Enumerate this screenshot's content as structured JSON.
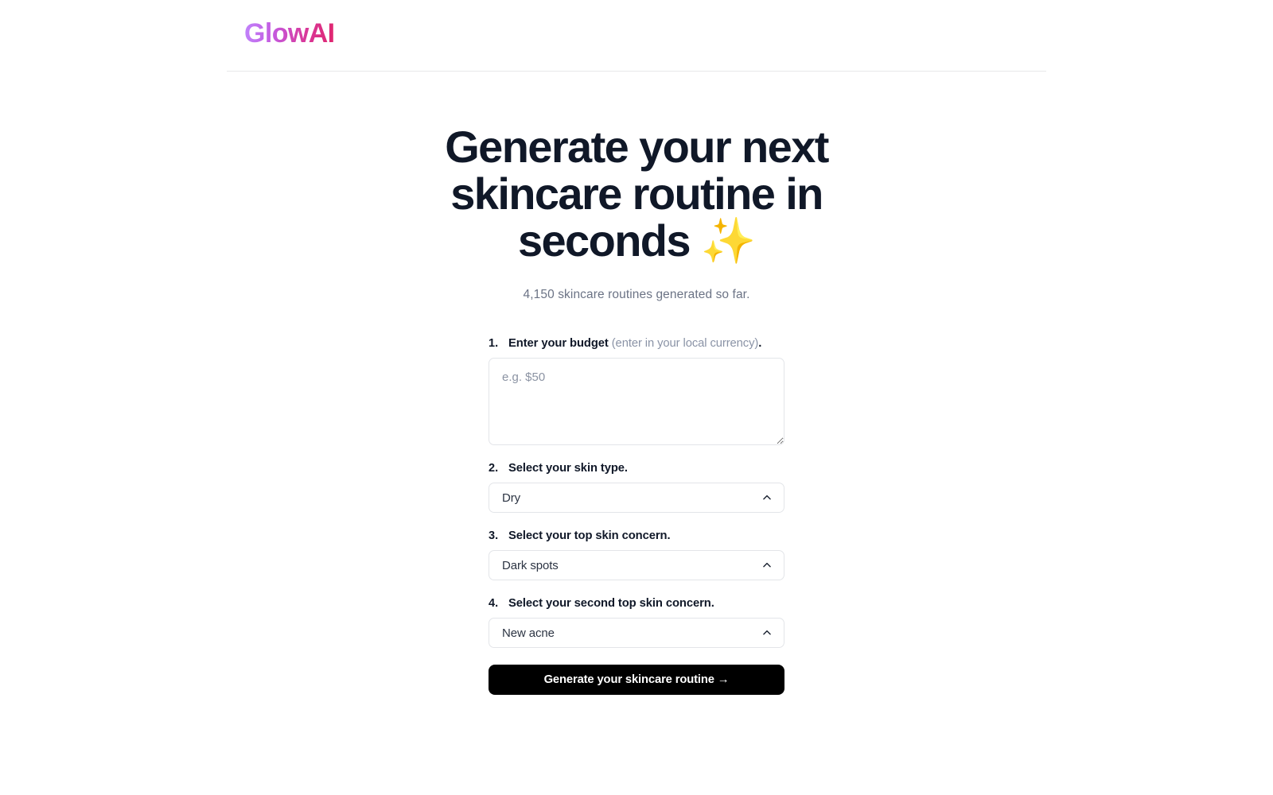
{
  "header": {
    "brand": "GlowAI"
  },
  "hero": {
    "title": "Generate your next skincare routine in seconds ✨",
    "subtitle": "4,150 skincare routines generated so far."
  },
  "form": {
    "steps": [
      {
        "number": "1.",
        "label": "Enter your budget ",
        "hint": "(enter in your local currency)",
        "label_suffix": ".",
        "control": "textarea",
        "placeholder": "e.g. $50",
        "value": ""
      },
      {
        "number": "2.",
        "label": "Select your skin type.",
        "control": "select",
        "value": "Dry"
      },
      {
        "number": "3.",
        "label": "Select your top skin concern.",
        "control": "select",
        "value": "Dark spots"
      },
      {
        "number": "4.",
        "label": "Select your second top skin concern.",
        "control": "select",
        "value": "New acne"
      }
    ],
    "submit_label": "Generate your skincare routine →"
  },
  "icons": {
    "chevron_up": "chevron-up-icon"
  },
  "colors": {
    "brand_gradient_start": "#c084fc",
    "brand_gradient_end": "#e0256c",
    "heading": "#101828",
    "muted": "#6b7385",
    "border": "#e3e5e9",
    "button_bg": "#000000"
  }
}
